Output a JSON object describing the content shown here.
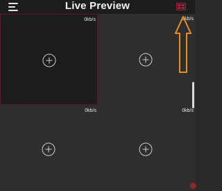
{
  "header": {
    "title": "Live Preview",
    "menu_icon": "hamburger-menu-icon",
    "layout_icon": "layout-icon"
  },
  "cells": [
    {
      "bitrate": "0kb/s",
      "selected": true,
      "action_icon": "add-circle-icon"
    },
    {
      "bitrate": "0kb/s",
      "selected": false,
      "action_icon": "add-circle-icon"
    },
    {
      "bitrate": "0kb/s",
      "selected": false,
      "action_icon": "add-circle-icon"
    },
    {
      "bitrate": "0kb/s",
      "selected": false,
      "action_icon": "add-circle-icon"
    }
  ],
  "annotation": {
    "icon": "arrow-up-icon",
    "color": "#f08a24"
  },
  "colors": {
    "header_bg": "#1d1d1d",
    "cell_bg": "#2e2e2e",
    "selected_cell_bg": "#1c1c1c",
    "selected_border": "#5a1f2a",
    "accent_red": "#a3243a"
  }
}
